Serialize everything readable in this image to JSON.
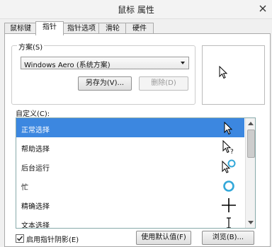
{
  "window": {
    "title": "鼠标 属性"
  },
  "tabs": [
    {
      "label": "鼠标键"
    },
    {
      "label": "指针"
    },
    {
      "label": "指针选项"
    },
    {
      "label": "滑轮"
    },
    {
      "label": "硬件"
    }
  ],
  "scheme": {
    "label": "方案(S)",
    "value": "Windows Aero (系统方案)",
    "save_as": "另存为(V)...",
    "delete": "删除(D)"
  },
  "custom": {
    "label": "自定义(C):",
    "items": [
      {
        "label": "正常选择",
        "icon": "arrow-cursor-icon"
      },
      {
        "label": "帮助选择",
        "icon": "help-cursor-icon"
      },
      {
        "label": "后台运行",
        "icon": "working-in-background-cursor-icon"
      },
      {
        "label": "忙",
        "icon": "busy-cursor-icon"
      },
      {
        "label": "精确选择",
        "icon": "precision-cursor-icon"
      },
      {
        "label": "文本选择",
        "icon": "text-cursor-icon"
      }
    ]
  },
  "footer": {
    "shadow_label": "启用指针阴影(E)",
    "shadow_checked": true,
    "default_btn": "使用默认值(F)",
    "browse_btn": "浏览(B)..."
  },
  "colors": {
    "selection": "#3c87e0",
    "busy_ring": "#33a8d9"
  }
}
